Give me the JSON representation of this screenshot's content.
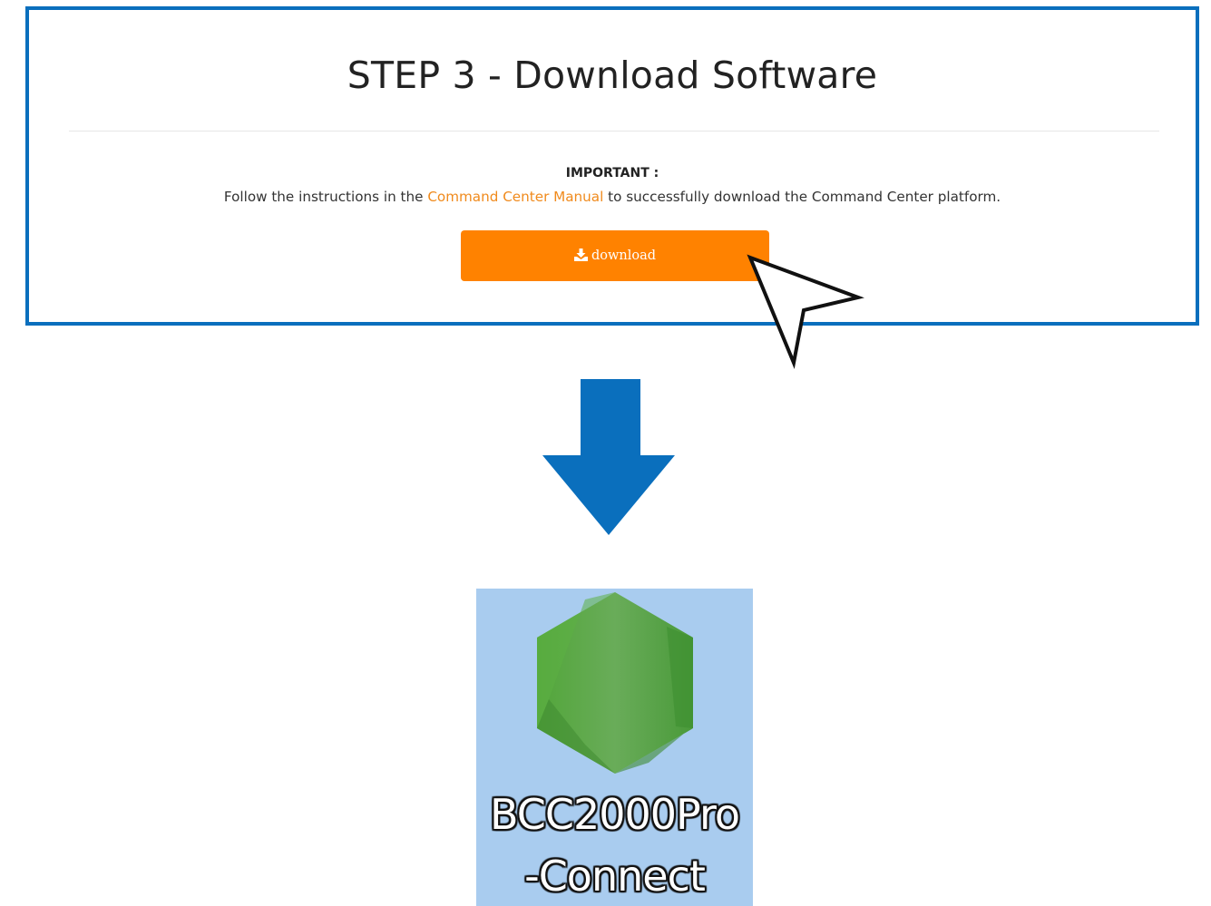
{
  "step_panel": {
    "title": "STEP 3 - Download Software",
    "important_label": "IMPORTANT :",
    "instructions_before": "Follow the instructions in the ",
    "instructions_link": "Command Center Manual",
    "instructions_after": " to successfully download the Command Center platform.",
    "download_label": "download",
    "download_icon": "download-icon"
  },
  "desktop_file": {
    "icon": "nodejs-hexagon-icon",
    "label_line1": "BCC2000Pro",
    "label_line2": "-Connect"
  },
  "colors": {
    "panel_border": "#0a6fbd",
    "link": "#f08a1c",
    "button": "#ff8200",
    "arrow": "#0a6fbd",
    "file_selection": "#a9ccef"
  }
}
